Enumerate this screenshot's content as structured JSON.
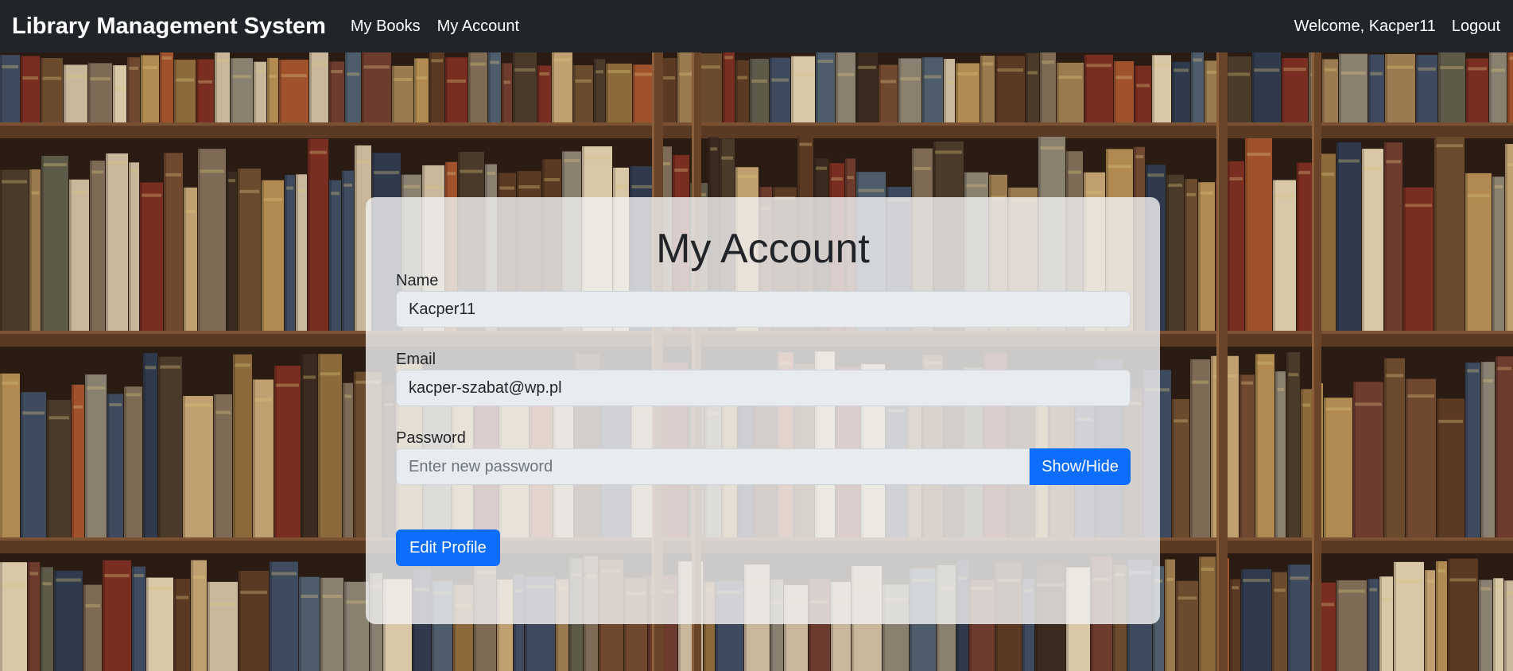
{
  "navbar": {
    "brand": "Library Management System",
    "links": [
      "My Books",
      "My Account"
    ],
    "welcome": "Welcome, Kacper11",
    "logout": "Logout"
  },
  "account": {
    "title": "My Account",
    "name_label": "Name",
    "name_value": "Kacper11",
    "email_label": "Email",
    "email_value": "kacper-szabat@wp.pl",
    "password_label": "Password",
    "password_placeholder": "Enter new password",
    "show_hide_label": "Show/Hide",
    "edit_profile_label": "Edit Profile"
  },
  "colors": {
    "navbar_bg": "#212529",
    "primary": "#0d6efd",
    "input_bg": "#e9ecef"
  }
}
